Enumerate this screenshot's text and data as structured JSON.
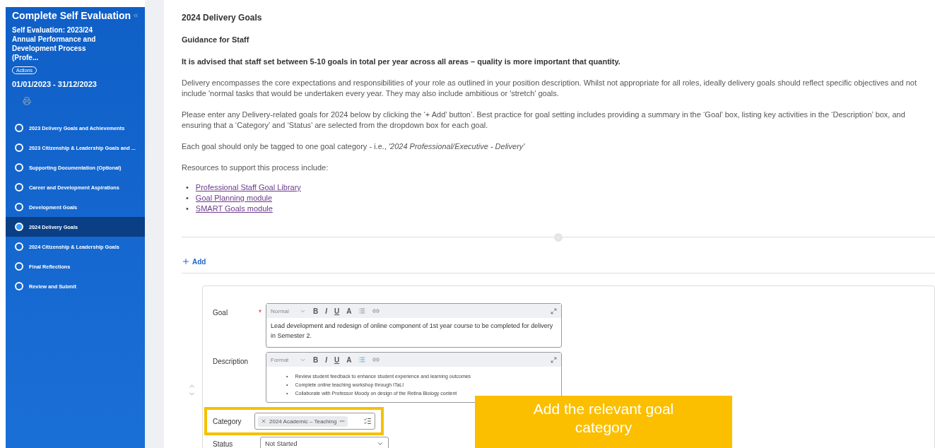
{
  "sidebar": {
    "title": "Complete Self Evaluation",
    "subtitle": "Self Evaluation: 2023/24 Annual Performance and Development Process (Profe...",
    "actions_button": "Actions",
    "period": "01/01/2023 - 31/12/2023",
    "steps": [
      {
        "label": "2023 Delivery Goals and Achievements",
        "selected": false
      },
      {
        "label": "2023 Citizenship & Leadership Goals and ...",
        "selected": false
      },
      {
        "label": "Supporting Documentation (Optional)",
        "selected": false
      },
      {
        "label": "Career and Development Aspirations",
        "selected": false
      },
      {
        "label": "Development Goals",
        "selected": false
      },
      {
        "label": "2024 Delivery Goals",
        "selected": true
      },
      {
        "label": "2024 Citizenship & Leadership Goals",
        "selected": false
      },
      {
        "label": "Final Reflections",
        "selected": false
      },
      {
        "label": "Review and Submit",
        "selected": false
      }
    ]
  },
  "main": {
    "heading": "2024 Delivery Goals",
    "subheading": "Guidance for Staff",
    "paragraphs": [
      {
        "kind": "bold",
        "text": "It is advised that staff set between 5-10 goals in total per year across all areas – quality is more important that quantity."
      },
      {
        "kind": "plain",
        "text": "Delivery encompasses the core expectations and responsibilities of your role as outlined in your position description.  Whilst not appropriate for all roles, ideally delivery goals should reflect specific objectives and not include 'normal tasks that would be undertaken every year. They may also include ambitious or 'stretch' goals."
      },
      {
        "kind": "plain",
        "text": "Please enter any Delivery-related goals for 2024 below by clicking the ‘+ Add’ button’.  Best practice for goal setting includes providing a summary in the ‘Goal’ box, listing key activities in the ‘Description’ box, and ensuring that a ‘Category’ and ‘Status’ are selected from the dropdown box for each goal."
      },
      {
        "kind": "plain",
        "text": "Each goal should only be tagged to one goal category - i.e., *'2024 Professional/Executive - Delivery'*"
      },
      {
        "kind": "plain",
        "text": "Resources to support this process include:"
      }
    ],
    "links": [
      {
        "marker": "•",
        "text": "Professional Staff Goal Library"
      },
      {
        "marker": "•",
        "text": "Goal Planning module "
      },
      {
        "marker": "•",
        "text": "SMART Goals module"
      }
    ],
    "add_button": "Add"
  },
  "goal_card": {
    "fields": [
      {
        "kind": "editor",
        "label": "Goal",
        "required_mark": "*",
        "format": "Normal",
        "toolbar_letters": [
          "B",
          "I",
          "U",
          "A"
        ],
        "list_active": false,
        "value": "Lead development and redesign of online component of 1st year course to be completed for delivery in Semester 2."
      },
      {
        "kind": "editor",
        "label": "Description",
        "format": "Format",
        "toolbar_letters": [
          "B",
          "I",
          "U",
          "A"
        ],
        "list_active": true,
        "bullets": [
          {
            "marker": "•",
            "text": "Review student feedback to enhance student experience and learning outcomes"
          },
          {
            "marker": "•",
            "text": "Complete online teaching workshop through ITaLI"
          },
          {
            "marker": "•",
            "text": "Collaborate with Professor Moody on design of the Retina Biology content"
          }
        ]
      },
      {
        "kind": "tags",
        "label": "Category",
        "highlighted": true,
        "tags": [
          "2024 Academic – Teaching"
        ]
      },
      {
        "kind": "select",
        "label": "Status",
        "value": "Not Started"
      }
    ]
  },
  "callout": {
    "text": "Add the relevant goal category"
  }
}
